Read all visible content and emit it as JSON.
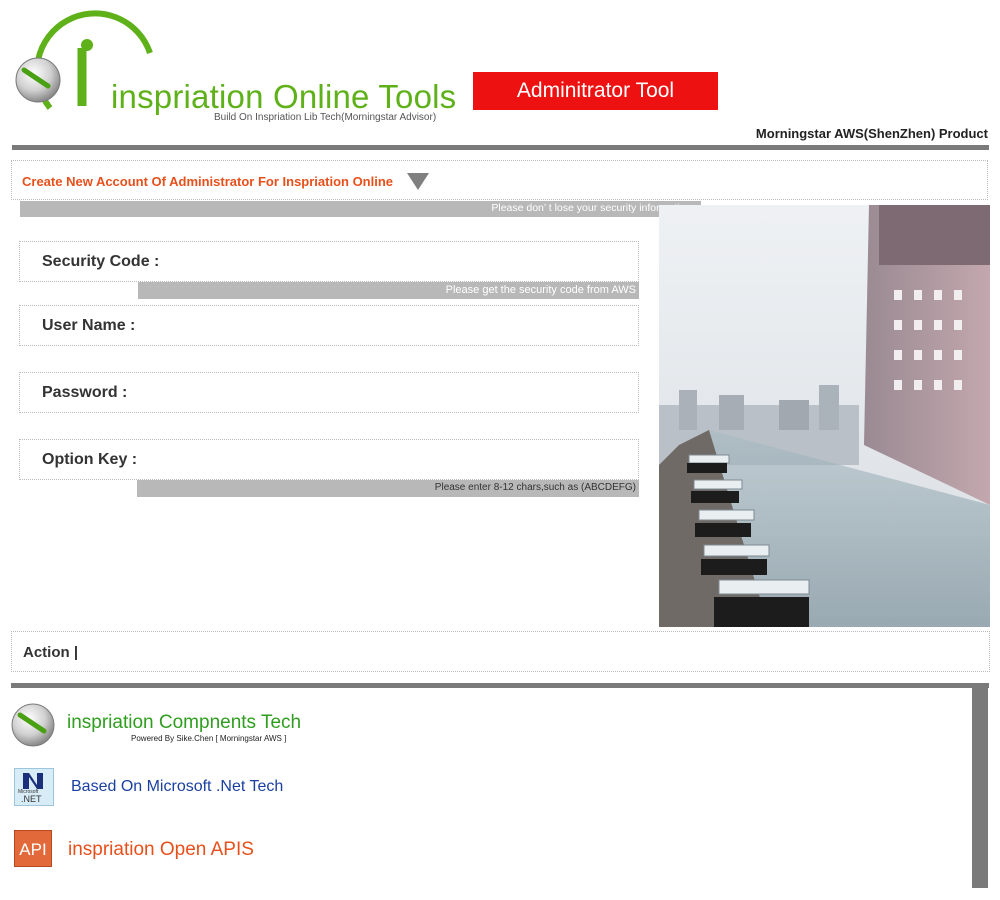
{
  "header": {
    "logo_title": "inspriation Online Tools",
    "logo_subtitle": "Build On Inspriation Lib Tech(Morningstar Advisor)",
    "badge": "Adminitrator Tool",
    "product": "Morningstar AWS(ShenZhen) Product"
  },
  "section": {
    "title": "Create New Account Of Administrator For Inspriation Online",
    "notice": "Please don’ t lose your security information ."
  },
  "form": {
    "fields": [
      {
        "label": "Security Code :",
        "value": "",
        "hint": "Please get the security code from AWS"
      },
      {
        "label": "User Name :",
        "value": ""
      },
      {
        "label": "Password :",
        "value": ""
      },
      {
        "label": "Option Key :",
        "value": "",
        "hint": "Please enter 8-12 chars,such as (ABCDEFG)"
      }
    ]
  },
  "action": {
    "label": "Action |"
  },
  "footer": {
    "tech_name": "inspriation Compnents Tech",
    "tech_sub": "Powered By Sike.Chen [ Morningstar AWS ]",
    "net_name": "Based On Microsoft .Net Tech",
    "net_icon_top": "Microsoft",
    "net_icon_bottom": ".NET",
    "api_icon": "API",
    "api_name": "inspriation Open APIS"
  },
  "colors": {
    "brand_green": "#5fb11a",
    "badge_red": "#ee1111",
    "accent_orange": "#e8501b",
    "net_blue": "#1a3fa0",
    "rule_gray": "#7a7a7a"
  },
  "icons": [
    "inspriation-logo-icon",
    "dropdown-triangle-icon",
    "dotnet-icon",
    "api-icon"
  ]
}
